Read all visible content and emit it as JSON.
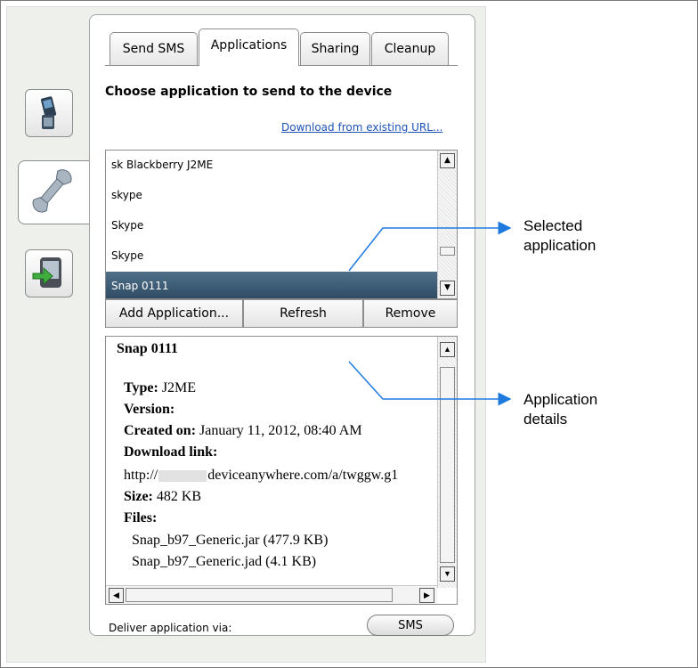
{
  "tabs": [
    "Send SMS",
    "Applications",
    "Sharing",
    "Cleanup"
  ],
  "active_tab": "Applications",
  "heading": "Choose application to send to the device",
  "download_link": "Download from existing URL...",
  "apps": {
    "items": [
      "sk Blackberry J2ME",
      "skype",
      "Skype",
      "Skype",
      "Snap 0111"
    ],
    "selected": "Snap 0111"
  },
  "actions": {
    "add": "Add Application...",
    "refresh": "Refresh",
    "remove": "Remove"
  },
  "details": {
    "title": "Snap 0111",
    "type_label": "Type:",
    "type_value": "J2ME",
    "version_label": "Version:",
    "created_label": "Created on:",
    "created_value": "January 11, 2012, 08:40 AM",
    "download_label": "Download link:",
    "download_prefix": "http://",
    "download_value": "deviceanywhere.com/a/twggw.g1",
    "size_label": "Size:",
    "size_value": "482 KB",
    "files_label": "Files:",
    "files": [
      "Snap_b97_Generic.jar (477.9 KB)",
      "Snap_b97_Generic.jad (4.1 KB)"
    ]
  },
  "deliver_label": "Deliver application via:",
  "deliver_button": "SMS",
  "callouts": {
    "selected_line1": "Selected",
    "selected_line2": "application",
    "details_line1": "Application",
    "details_line2": "details"
  },
  "colors": {
    "selection": "#3b5a75",
    "callout": "#1f7ae0",
    "link": "#1d52b6"
  },
  "icons": [
    "phone-icon",
    "wrench-icon",
    "device-arrow-icon"
  ]
}
